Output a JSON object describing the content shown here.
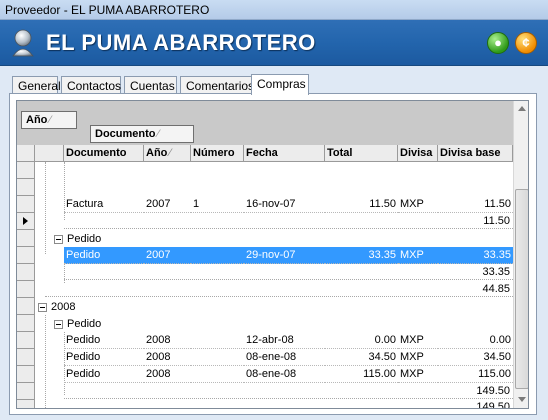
{
  "window": {
    "title": "Proveedor - EL PUMA ABARROTERO"
  },
  "header": {
    "app_name": "EL PUMA ABARROTERO",
    "green_icon": "circle-icon",
    "orange_icon": "currency-icon",
    "orange_glyph": "¢"
  },
  "tabs": [
    {
      "label": "General"
    },
    {
      "label": "Contactos"
    },
    {
      "label": "Cuentas"
    },
    {
      "label": "Comentarios"
    },
    {
      "label": "Compras"
    }
  ],
  "grid": {
    "group_by": [
      {
        "label": "Año",
        "sort": "⁄"
      },
      {
        "label": "Documento",
        "sort": "⁄"
      }
    ],
    "columns": [
      {
        "label": "Documento"
      },
      {
        "label": "Año",
        "sort": "⁄"
      },
      {
        "label": "Número"
      },
      {
        "label": "Fecha"
      },
      {
        "label": "Total"
      },
      {
        "label": "Divisa"
      },
      {
        "label": "Divisa base"
      }
    ],
    "rows": [
      {
        "documento": "Factura",
        "anio": "2007",
        "numero": "1",
        "fecha": "16-nov-07",
        "total": "11.50",
        "divisa": "MXP",
        "divisa_base": "11.50"
      },
      {
        "documento": "Pedido",
        "anio": "2007",
        "numero": "",
        "fecha": "29-nov-07",
        "total": "33.35",
        "divisa": "MXP",
        "divisa_base": "33.35"
      },
      {
        "documento": "Pedido",
        "anio": "2008",
        "numero": "",
        "fecha": "12-abr-08",
        "total": "0.00",
        "divisa": "MXP",
        "divisa_base": "0.00"
      },
      {
        "documento": "Pedido",
        "anio": "2008",
        "numero": "",
        "fecha": "08-ene-08",
        "total": "34.50",
        "divisa": "MXP",
        "divisa_base": "34.50"
      },
      {
        "documento": "Pedido",
        "anio": "2008",
        "numero": "",
        "fecha": "08-ene-08",
        "total": "115.00",
        "divisa": "MXP",
        "divisa_base": "115.00"
      }
    ],
    "groups": {
      "pedido_label": "Pedido",
      "year_2008": "2008"
    },
    "totals": {
      "factura_2007": "11.50",
      "pedido_2007": "33.35",
      "year_2007": "44.85",
      "pedido_2008": "149.50",
      "year_2008": "149.50"
    }
  },
  "colors": {
    "header_blue": "#2365ad",
    "selection": "#3399ff",
    "group_area": "#c9c9c9"
  }
}
